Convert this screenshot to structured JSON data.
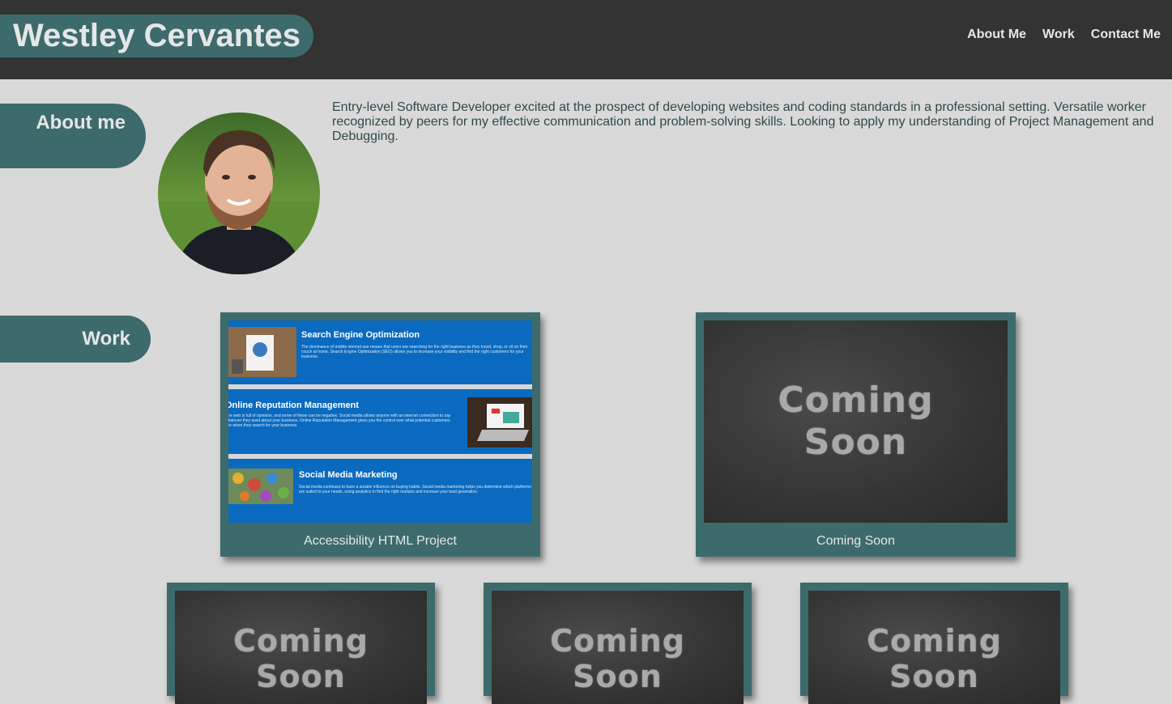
{
  "header": {
    "title": "Westley Cervantes",
    "nav": [
      "About Me",
      "Work",
      "Contact Me"
    ]
  },
  "about": {
    "label": "About me",
    "text": "Entry-level Software Developer excited at the prospect of developing websites and coding standards in a professional setting. Versatile worker recognized by peers for my effective communication and problem-solving skills. Looking to apply my understanding of Project Management and Debugging."
  },
  "work": {
    "label": "Work",
    "projects": [
      {
        "caption": "Accessibility HTML Project",
        "preview": {
          "rows": [
            {
              "title": "Search Engine Optimization",
              "text": "The dominance of mobile internet use means that users are searching for the right business as they travel, shop, or sit on their couch at home. Search Engine Optimization (SEO) allows you to increase your visibility and find the right customers for your business."
            },
            {
              "title": "Online Reputation Management",
              "text": "The web is full of opinions, and some of these can be negative. Social media allows anyone with an internet connection to say whatever they want about your business. Online Reputation Management gives you the control over what potential customers see when they search for your business."
            },
            {
              "title": "Social Media Marketing",
              "text": "Social media continues to have a sizable influence on buying habits. Social media marketing helps you determine which platforms are suited to your needs, using analytics to find the right markets and increase your lead generation."
            }
          ]
        }
      },
      {
        "caption": "Coming Soon",
        "image_text": [
          "Coming",
          "Soon"
        ]
      },
      {
        "image_text": [
          "Coming",
          "Soon"
        ]
      },
      {
        "image_text": [
          "Coming",
          "Soon"
        ]
      },
      {
        "image_text": [
          "Coming",
          "Soon"
        ]
      }
    ]
  },
  "colors": {
    "header_bg": "#333333",
    "accent": "#3d6b6b",
    "page_bg": "#d9d9d9",
    "text": "#2f4a4a"
  }
}
